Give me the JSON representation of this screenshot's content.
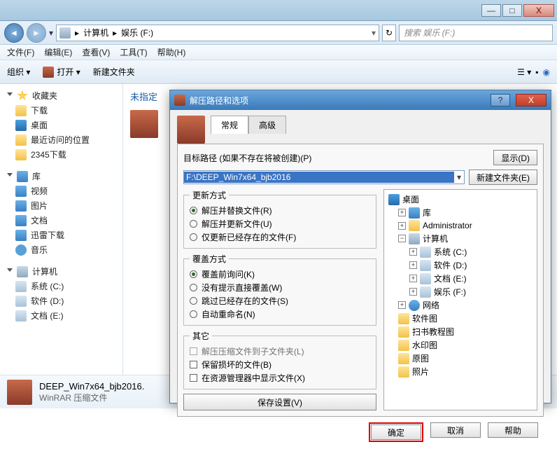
{
  "titlebar": {
    "min": "—",
    "max": "□",
    "close": "X"
  },
  "address": {
    "computer": "计算机",
    "drive": "娱乐 (F:)"
  },
  "search": {
    "placeholder": "搜索 娱乐 (F:)"
  },
  "menu": {
    "file": "文件(F)",
    "edit": "编辑(E)",
    "view": "查看(V)",
    "tools": "工具(T)",
    "help": "帮助(H)"
  },
  "toolbar": {
    "org": "组织 ▾",
    "open": "打开 ▾",
    "newfolder": "新建文件夹"
  },
  "sidebar": {
    "fav": "收藏夹",
    "fav_items": [
      "下载",
      "桌面",
      "最近访问的位置",
      "2345下载"
    ],
    "lib": "库",
    "lib_items": [
      "视频",
      "图片",
      "文档",
      "迅雷下载",
      "音乐"
    ],
    "comp": "计算机",
    "comp_items": [
      "系统 (C:)",
      "软件 (D:)",
      "文档 (E:)"
    ]
  },
  "content": {
    "heading": "未指定"
  },
  "filebar": {
    "name": "DEEP_Win7x64_bjb2016.",
    "type": "WinRAR 压缩文件"
  },
  "dialog": {
    "title": "解压路径和选项",
    "tabs": {
      "general": "常规",
      "advanced": "高级"
    },
    "pathlabel": "目标路径 (如果不存在将被创建)(P)",
    "show": "显示(D)",
    "newfolder": "新建文件夹(E)",
    "path": "F:\\DEEP_Win7x64_bjb2016",
    "update": {
      "legend": "更新方式",
      "r1": "解压并替换文件(R)",
      "r2": "解压并更新文件(U)",
      "r3": "仅更新已经存在的文件(F)"
    },
    "overwrite": {
      "legend": "覆盖方式",
      "r1": "覆盖前询问(K)",
      "r2": "没有提示直接覆盖(W)",
      "r3": "跳过已经存在的文件(S)",
      "r4": "自动重命名(N)"
    },
    "other": {
      "legend": "其它",
      "c1": "解压压缩文件到子文件夹(L)",
      "c2": "保留损坏的文件(B)",
      "c3": "在资源管理器中显示文件(X)"
    },
    "save": "保存设置(V)",
    "tree": {
      "desktop": "桌面",
      "lib": "库",
      "admin": "Administrator",
      "computer": "计算机",
      "sys": "系统 (C:)",
      "soft": "软件 (D:)",
      "doc": "文档 (E:)",
      "ent": "娱乐 (F:)",
      "net": "网络",
      "folders": [
        "软件图",
        "扫书教程图",
        "水印图",
        "原图",
        "照片"
      ]
    },
    "ok": "确定",
    "cancel": "取消",
    "help": "帮助"
  }
}
